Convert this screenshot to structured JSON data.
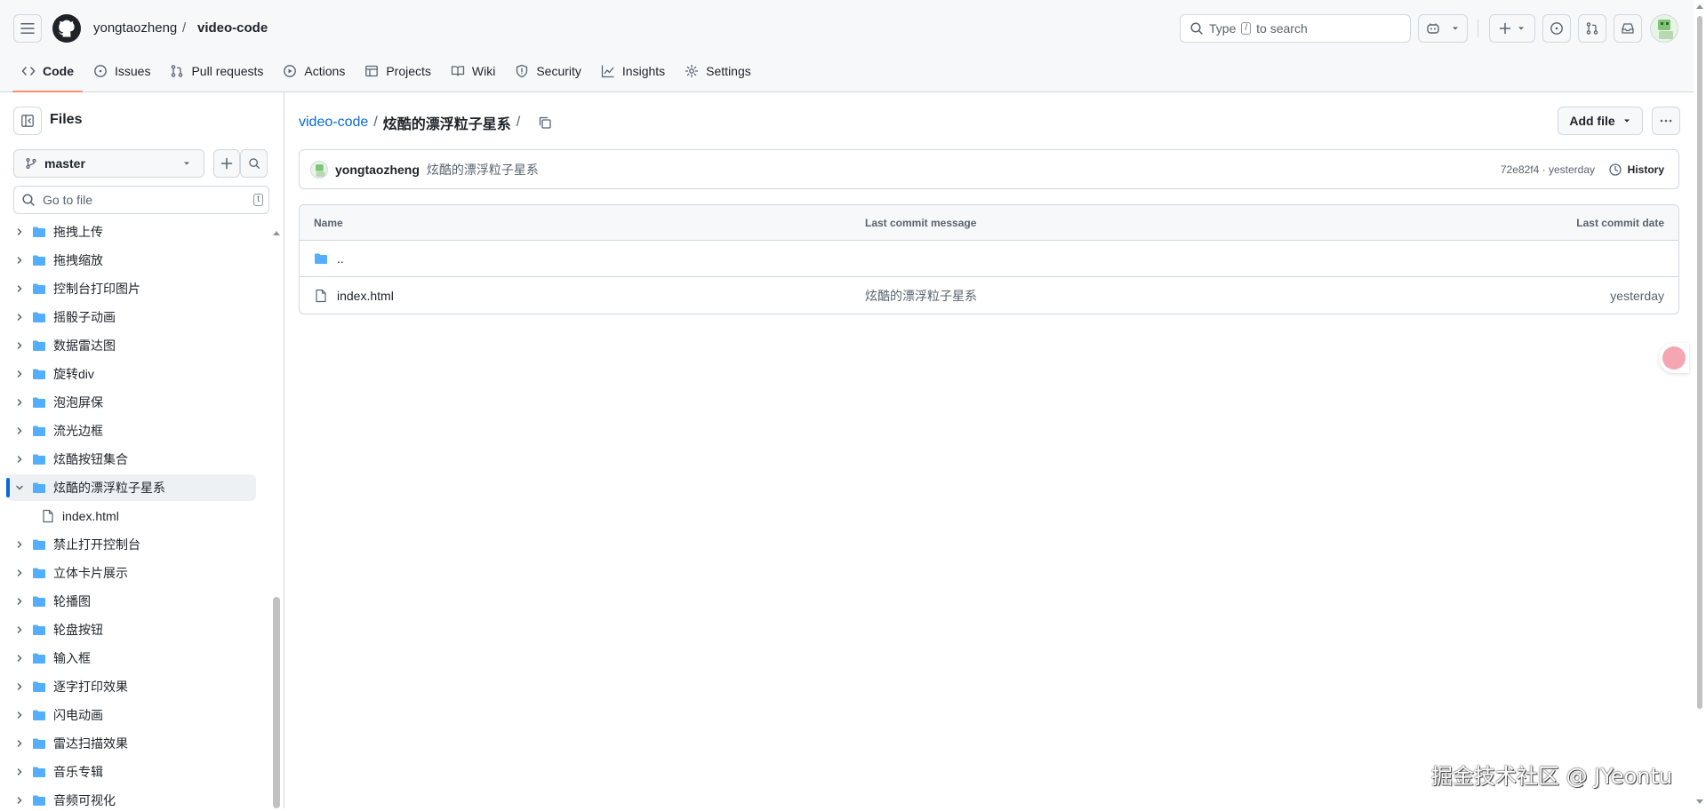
{
  "header": {
    "owner": "yongtaozheng",
    "repo": "video-code",
    "separator": "/",
    "search_prefix": "Type",
    "search_key": "/",
    "search_suffix": "to search"
  },
  "tabs": [
    {
      "label": "Code",
      "icon": "code-icon"
    },
    {
      "label": "Issues",
      "icon": "issue-icon"
    },
    {
      "label": "Pull requests",
      "icon": "pull-request-icon"
    },
    {
      "label": "Actions",
      "icon": "play-icon"
    },
    {
      "label": "Projects",
      "icon": "table-icon"
    },
    {
      "label": "Wiki",
      "icon": "book-icon"
    },
    {
      "label": "Security",
      "icon": "shield-icon"
    },
    {
      "label": "Insights",
      "icon": "graph-icon"
    },
    {
      "label": "Settings",
      "icon": "gear-icon"
    }
  ],
  "sidebar": {
    "title": "Files",
    "branch": "master",
    "goto_placeholder": "Go to file",
    "goto_key": "t",
    "tree": [
      {
        "label": "拖拽上传",
        "type": "dir",
        "expanded": false
      },
      {
        "label": "拖拽缩放",
        "type": "dir",
        "expanded": false
      },
      {
        "label": "控制台打印图片",
        "type": "dir",
        "expanded": false
      },
      {
        "label": "摇骰子动画",
        "type": "dir",
        "expanded": false
      },
      {
        "label": "数据雷达图",
        "type": "dir",
        "expanded": false
      },
      {
        "label": "旋转div",
        "type": "dir",
        "expanded": false
      },
      {
        "label": "泡泡屏保",
        "type": "dir",
        "expanded": false
      },
      {
        "label": "流光边框",
        "type": "dir",
        "expanded": false
      },
      {
        "label": "炫酷按钮集合",
        "type": "dir",
        "expanded": false
      },
      {
        "label": "炫酷的漂浮粒子星系",
        "type": "dir",
        "expanded": true,
        "selected": true
      },
      {
        "label": "index.html",
        "type": "file",
        "child": true
      },
      {
        "label": "禁止打开控制台",
        "type": "dir",
        "expanded": false
      },
      {
        "label": "立体卡片展示",
        "type": "dir",
        "expanded": false
      },
      {
        "label": "轮播图",
        "type": "dir",
        "expanded": false
      },
      {
        "label": "轮盘按钮",
        "type": "dir",
        "expanded": false
      },
      {
        "label": "输入框",
        "type": "dir",
        "expanded": false
      },
      {
        "label": "逐字打印效果",
        "type": "dir",
        "expanded": false
      },
      {
        "label": "闪电动画",
        "type": "dir",
        "expanded": false
      },
      {
        "label": "雷达扫描效果",
        "type": "dir",
        "expanded": false
      },
      {
        "label": "音乐专辑",
        "type": "dir",
        "expanded": false
      },
      {
        "label": "音频可视化",
        "type": "dir",
        "expanded": false
      }
    ]
  },
  "main": {
    "breadcrumb_root": "video-code",
    "breadcrumb_current": "炫酷的漂浮粒子星系",
    "breadcrumb_sep": "/",
    "add_file": "Add file",
    "commit": {
      "author": "yongtaozheng",
      "message": "炫酷的漂浮粒子星系",
      "hash_time": "72e82f4 · yesterday",
      "history": "History"
    },
    "table": {
      "headers": {
        "name": "Name",
        "message": "Last commit message",
        "date": "Last commit date"
      },
      "parent": "..",
      "rows": [
        {
          "name": "index.html",
          "message": "炫酷的漂浮粒子星系",
          "date": "yesterday"
        }
      ]
    }
  },
  "watermark": "掘金技术社区 @ JYeontu",
  "colors": {
    "accent": "#0969da",
    "folder": "#54aeff",
    "tab_underline": "#fd8c73"
  }
}
